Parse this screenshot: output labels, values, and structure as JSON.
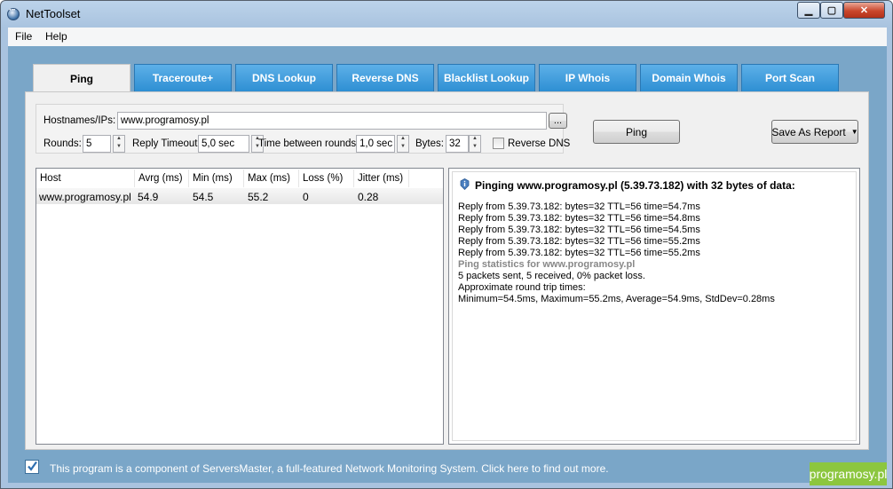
{
  "window": {
    "title": "NetToolset"
  },
  "menu": {
    "file": "File",
    "help": "Help"
  },
  "tabs": [
    {
      "label": "Ping"
    },
    {
      "label": "Traceroute+"
    },
    {
      "label": "DNS Lookup"
    },
    {
      "label": "Reverse DNS"
    },
    {
      "label": "Blacklist Lookup"
    },
    {
      "label": "IP Whois"
    },
    {
      "label": "Domain Whois"
    },
    {
      "label": "Port Scan"
    }
  ],
  "form": {
    "hostnames_label": "Hostnames/IPs:",
    "hostnames_value": "www.programosy.pl",
    "browse_label": "...",
    "rounds_label": "Rounds:",
    "rounds_value": "5",
    "reply_timeout_label": "Reply Timeout:",
    "reply_timeout_value": "5,0 sec",
    "between_rounds_label": "Time between rounds:",
    "between_rounds_value": "1,0 sec",
    "bytes_label": "Bytes:",
    "bytes_value": "32",
    "reverse_dns_label": "Reverse DNS",
    "ping_button": "Ping",
    "save_report_button": "Save As Report"
  },
  "results": {
    "columns": [
      "Host",
      "Avrg (ms)",
      "Min (ms)",
      "Max (ms)",
      "Loss (%)",
      "Jitter (ms)"
    ],
    "rows": [
      [
        "www.programosy.pl",
        "54.9",
        "54.5",
        "55.2",
        "0",
        "0.28"
      ]
    ]
  },
  "output": {
    "heading": "Pinging www.programosy.pl (5.39.73.182) with 32 bytes of data:",
    "lines": [
      "Reply from 5.39.73.182: bytes=32 TTL=56 time=54.7ms",
      "Reply from 5.39.73.182: bytes=32 TTL=56 time=54.8ms",
      "Reply from 5.39.73.182: bytes=32 TTL=56 time=54.5ms",
      "Reply from 5.39.73.182: bytes=32 TTL=56 time=55.2ms",
      "Reply from 5.39.73.182: bytes=32 TTL=56 time=55.2ms"
    ],
    "stats_heading": "Ping statistics for www.programosy.pl",
    "stats_lines": [
      "5 packets sent, 5 received, 0% packet loss.",
      "Approximate round trip times:",
      "Minimum=54.5ms, Maximum=55.2ms, Average=54.9ms, StdDev=0.28ms"
    ]
  },
  "footer": {
    "text": "This program is a component of ServersMaster, a full-featured Network Monitoring System. Click here to find out more.",
    "watermark": "programosy.pl"
  }
}
